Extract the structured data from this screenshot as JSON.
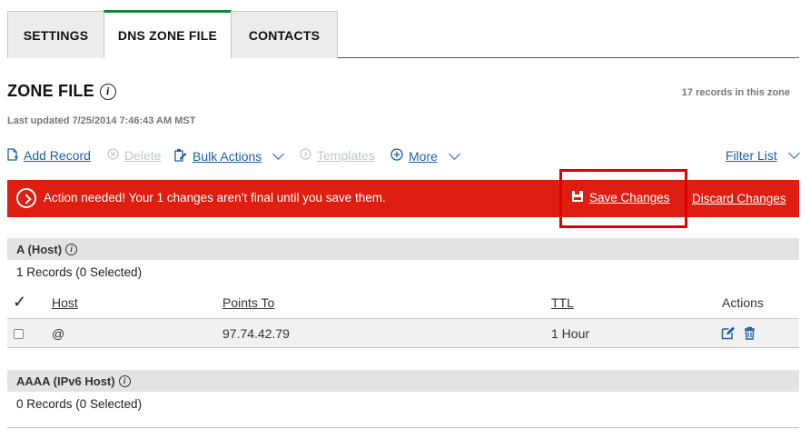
{
  "tabs": [
    {
      "label": "SETTINGS"
    },
    {
      "label": "DNS ZONE FILE"
    },
    {
      "label": "CONTACTS"
    }
  ],
  "zone": {
    "title": "ZONE FILE",
    "records_count": "17 records in this zone",
    "last_updated": "Last updated 7/25/2014 7:46:43 AM MST"
  },
  "toolbar": {
    "add_record": "Add Record",
    "delete": "Delete",
    "bulk_actions": "Bulk Actions",
    "templates": "Templates",
    "more": "More",
    "filter_list": "Filter List"
  },
  "alert": {
    "message": "Action needed! Your 1 changes aren’t final until you save them.",
    "save": "Save Changes",
    "discard": "Discard Changes"
  },
  "sections": [
    {
      "title": "A (Host)",
      "records": "1 Records (0 Selected)",
      "columns": {
        "host": "Host",
        "points_to": "Points To",
        "ttl": "TTL",
        "actions": "Actions"
      },
      "rows": [
        {
          "host": "@",
          "points_to": "97.74.42.79",
          "ttl": "1 Hour"
        }
      ]
    },
    {
      "title": "AAAA (IPv6 Host)",
      "records": "0 Records (0 Selected)"
    }
  ],
  "colors": {
    "accent_green": "#0f8a3c",
    "alert_red": "#dd1e11",
    "link_blue": "#1f5fa6",
    "highlight_red": "#e00000"
  }
}
